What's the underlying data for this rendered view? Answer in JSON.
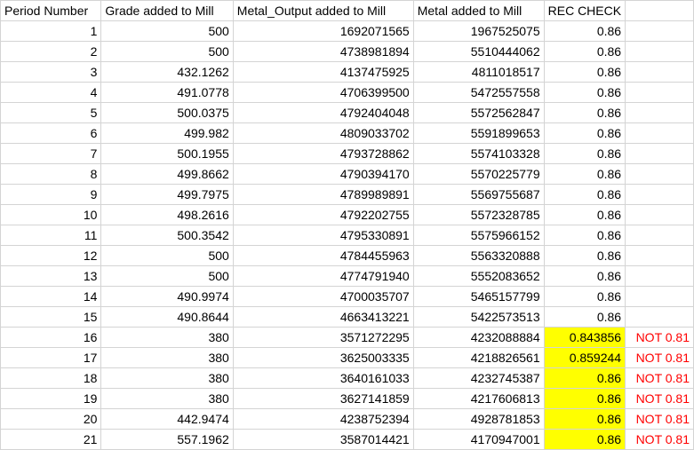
{
  "columns": [
    "Period Number",
    "Grade added to Mill",
    "Metal_Output added to Mill",
    "Metal added to Mill",
    "REC CHECK",
    ""
  ],
  "rows": [
    {
      "period": "1",
      "grade": "500",
      "metal_output": "1692071565",
      "metal": "1967525075",
      "rec": "0.86",
      "highlight": false,
      "note": ""
    },
    {
      "period": "2",
      "grade": "500",
      "metal_output": "4738981894",
      "metal": "5510444062",
      "rec": "0.86",
      "highlight": false,
      "note": ""
    },
    {
      "period": "3",
      "grade": "432.1262",
      "metal_output": "4137475925",
      "metal": "4811018517",
      "rec": "0.86",
      "highlight": false,
      "note": ""
    },
    {
      "period": "4",
      "grade": "491.0778",
      "metal_output": "4706399500",
      "metal": "5472557558",
      "rec": "0.86",
      "highlight": false,
      "note": ""
    },
    {
      "period": "5",
      "grade": "500.0375",
      "metal_output": "4792404048",
      "metal": "5572562847",
      "rec": "0.86",
      "highlight": false,
      "note": ""
    },
    {
      "period": "6",
      "grade": "499.982",
      "metal_output": "4809033702",
      "metal": "5591899653",
      "rec": "0.86",
      "highlight": false,
      "note": ""
    },
    {
      "period": "7",
      "grade": "500.1955",
      "metal_output": "4793728862",
      "metal": "5574103328",
      "rec": "0.86",
      "highlight": false,
      "note": ""
    },
    {
      "period": "8",
      "grade": "499.8662",
      "metal_output": "4790394170",
      "metal": "5570225779",
      "rec": "0.86",
      "highlight": false,
      "note": ""
    },
    {
      "period": "9",
      "grade": "499.7975",
      "metal_output": "4789989891",
      "metal": "5569755687",
      "rec": "0.86",
      "highlight": false,
      "note": ""
    },
    {
      "period": "10",
      "grade": "498.2616",
      "metal_output": "4792202755",
      "metal": "5572328785",
      "rec": "0.86",
      "highlight": false,
      "note": ""
    },
    {
      "period": "11",
      "grade": "500.3542",
      "metal_output": "4795330891",
      "metal": "5575966152",
      "rec": "0.86",
      "highlight": false,
      "note": ""
    },
    {
      "period": "12",
      "grade": "500",
      "metal_output": "4784455963",
      "metal": "5563320888",
      "rec": "0.86",
      "highlight": false,
      "note": ""
    },
    {
      "period": "13",
      "grade": "500",
      "metal_output": "4774791940",
      "metal": "5552083652",
      "rec": "0.86",
      "highlight": false,
      "note": ""
    },
    {
      "period": "14",
      "grade": "490.9974",
      "metal_output": "4700035707",
      "metal": "5465157799",
      "rec": "0.86",
      "highlight": false,
      "note": ""
    },
    {
      "period": "15",
      "grade": "490.8644",
      "metal_output": "4663413221",
      "metal": "5422573513",
      "rec": "0.86",
      "highlight": false,
      "note": ""
    },
    {
      "period": "16",
      "grade": "380",
      "metal_output": "3571272295",
      "metal": "4232088884",
      "rec": "0.843856",
      "highlight": true,
      "note": "NOT 0.81"
    },
    {
      "period": "17",
      "grade": "380",
      "metal_output": "3625003335",
      "metal": "4218826561",
      "rec": "0.859244",
      "highlight": true,
      "note": "NOT 0.81"
    },
    {
      "period": "18",
      "grade": "380",
      "metal_output": "3640161033",
      "metal": "4232745387",
      "rec": "0.86",
      "highlight": true,
      "note": "NOT 0.81"
    },
    {
      "period": "19",
      "grade": "380",
      "metal_output": "3627141859",
      "metal": "4217606813",
      "rec": "0.86",
      "highlight": true,
      "note": "NOT 0.81"
    },
    {
      "period": "20",
      "grade": "442.9474",
      "metal_output": "4238752394",
      "metal": "4928781853",
      "rec": "0.86",
      "highlight": true,
      "note": "NOT 0.81"
    },
    {
      "period": "21",
      "grade": "557.1962",
      "metal_output": "3587014421",
      "metal": "4170947001",
      "rec": "0.86",
      "highlight": true,
      "note": "NOT 0.81"
    }
  ],
  "colors": {
    "highlight": "#ffff00",
    "note": "#ff0000",
    "grid": "#d4d4d4"
  }
}
